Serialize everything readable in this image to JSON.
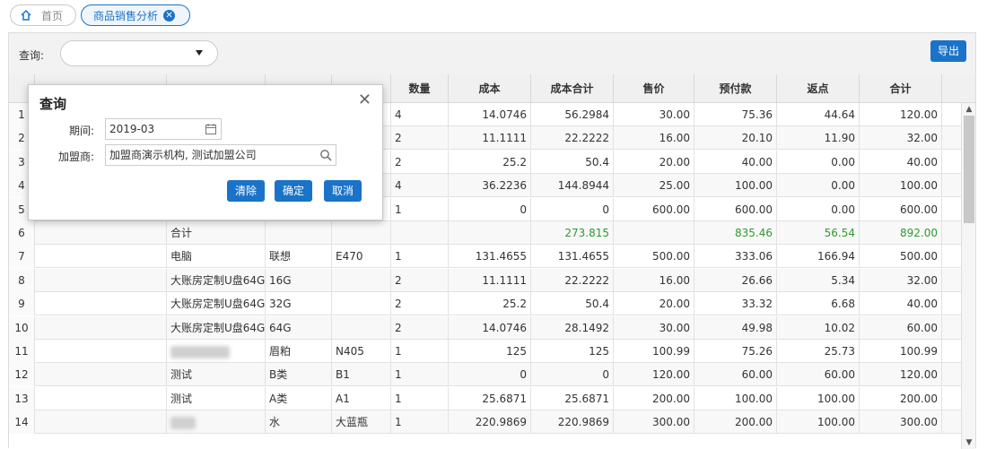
{
  "tabs": {
    "home_label": "首页",
    "active_label": "商品销售分析"
  },
  "toolbar": {
    "query_label": "查询:",
    "export_label": "导出"
  },
  "columns": [
    "",
    "",
    "",
    "",
    "",
    "数量",
    "成本",
    "成本合计",
    "售价",
    "预付款",
    "返点",
    "合计"
  ],
  "rows": [
    {
      "n": "1",
      "c1": "",
      "c2": "",
      "c3": "",
      "c4": "",
      "qty": "4",
      "cost": "14.0746",
      "costsum": "56.2984",
      "price": "30.00",
      "prepay": "75.36",
      "rebate": "44.64",
      "total": "120.00"
    },
    {
      "n": "2",
      "c1": "",
      "c2": "",
      "c3": "",
      "c4": "",
      "qty": "2",
      "cost": "11.1111",
      "costsum": "22.2222",
      "price": "16.00",
      "prepay": "20.10",
      "rebate": "11.90",
      "total": "32.00"
    },
    {
      "n": "3",
      "c1": "",
      "c2": "",
      "c3": "",
      "c4": "",
      "qty": "2",
      "cost": "25.2",
      "costsum": "50.4",
      "price": "20.00",
      "prepay": "40.00",
      "rebate": "0.00",
      "total": "40.00"
    },
    {
      "n": "4",
      "c1": "",
      "c2": "",
      "c3": "",
      "c4": "",
      "qty": "4",
      "cost": "36.2236",
      "costsum": "144.8944",
      "price": "25.00",
      "prepay": "100.00",
      "rebate": "0.00",
      "total": "100.00"
    },
    {
      "n": "5",
      "c1": "",
      "c2": "",
      "c3": "",
      "c4": "",
      "qty": "1",
      "cost": "0",
      "costsum": "0",
      "price": "600.00",
      "prepay": "600.00",
      "rebate": "0.00",
      "total": "600.00"
    },
    {
      "n": "6",
      "c1": "",
      "c2": "合计",
      "c3": "",
      "c4": "",
      "qty": "",
      "cost": "",
      "costsum": "273.815",
      "price": "",
      "prepay": "835.46",
      "rebate": "56.54",
      "total": "892.00"
    },
    {
      "n": "7",
      "c1": "",
      "c2": "电脑",
      "c3": "联想",
      "c4": "E470",
      "qty": "1",
      "cost": "131.4655",
      "costsum": "131.4655",
      "price": "500.00",
      "prepay": "333.06",
      "rebate": "166.94",
      "total": "500.00"
    },
    {
      "n": "8",
      "c1": "",
      "c2": "大账房定制U盘64G",
      "c3": "16G",
      "c4": "",
      "qty": "2",
      "cost": "11.1111",
      "costsum": "22.2222",
      "price": "16.00",
      "prepay": "26.66",
      "rebate": "5.34",
      "total": "32.00"
    },
    {
      "n": "9",
      "c1": "",
      "c2": "大账房定制U盘64G",
      "c3": "32G",
      "c4": "",
      "qty": "2",
      "cost": "25.2",
      "costsum": "50.4",
      "price": "20.00",
      "prepay": "33.32",
      "rebate": "6.68",
      "total": "40.00"
    },
    {
      "n": "10",
      "c1": "",
      "c2": "大账房定制U盘64G",
      "c3": "64G",
      "c4": "",
      "qty": "2",
      "cost": "14.0746",
      "costsum": "28.1492",
      "price": "30.00",
      "prepay": "49.98",
      "rebate": "10.02",
      "total": "60.00"
    },
    {
      "n": "11",
      "c1": "",
      "c2": "",
      "c3": "眉粕",
      "c4": "N405",
      "qty": "1",
      "cost": "125",
      "costsum": "125",
      "price": "100.99",
      "prepay": "75.26",
      "rebate": "25.73",
      "total": "100.99"
    },
    {
      "n": "12",
      "c1": "",
      "c2": "测试",
      "c3": "B类",
      "c4": "B1",
      "qty": "1",
      "cost": "0",
      "costsum": "0",
      "price": "120.00",
      "prepay": "60.00",
      "rebate": "60.00",
      "total": "120.00"
    },
    {
      "n": "13",
      "c1": "",
      "c2": "测试",
      "c3": "A类",
      "c4": "A1",
      "qty": "1",
      "cost": "25.6871",
      "costsum": "25.6871",
      "price": "200.00",
      "prepay": "100.00",
      "rebate": "100.00",
      "total": "200.00"
    },
    {
      "n": "14",
      "c1": "",
      "c2": "",
      "c3": "水",
      "c4": "大蓝瓶",
      "qty": "1",
      "cost": "220.9869",
      "costsum": "220.9869",
      "price": "300.00",
      "prepay": "200.00",
      "rebate": "100.00",
      "total": "300.00"
    }
  ],
  "popup": {
    "title": "查询",
    "period_label": "期间:",
    "period_value": "2019-03",
    "franchisee_label": "加盟商:",
    "franchisee_value": "加盟商演示机构, 测试加盟公司",
    "clear_label": "清除",
    "confirm_label": "确定",
    "cancel_label": "取消"
  }
}
